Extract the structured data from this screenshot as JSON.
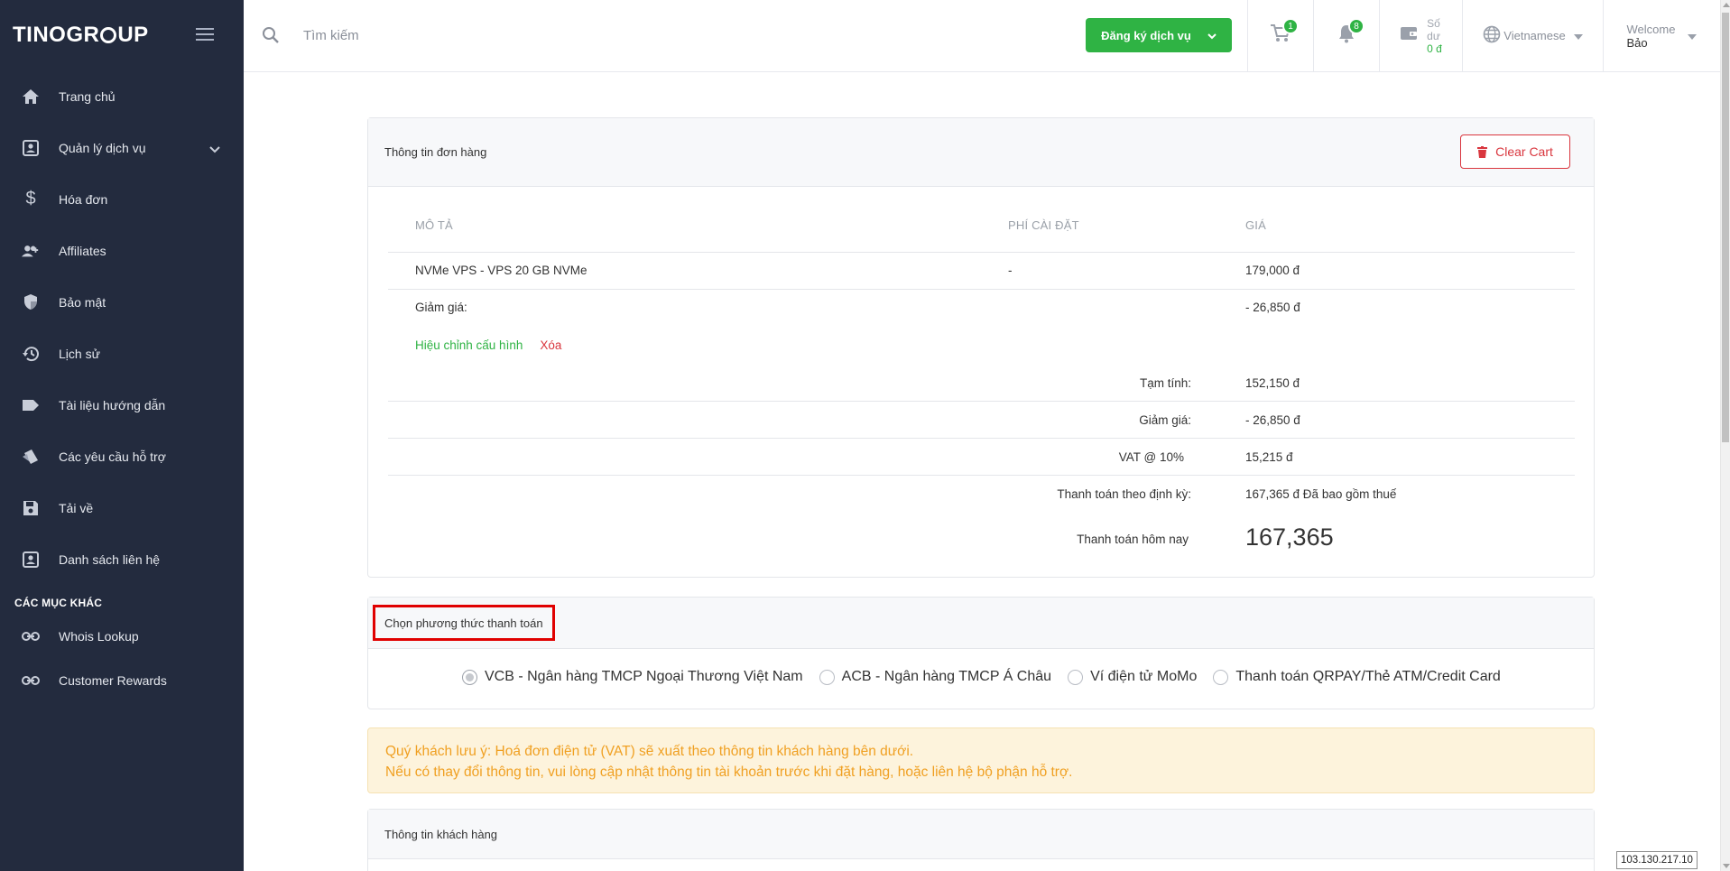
{
  "sidebar": {
    "logo": {
      "part1": "TINO",
      "part2": "GR",
      "part3": "UP"
    },
    "items": [
      {
        "label": "Trang chủ",
        "icon": "home-icon"
      },
      {
        "label": "Quản lý dịch vụ",
        "icon": "account-box-icon"
      },
      {
        "label": "Hóa đơn",
        "icon": "dollar-icon"
      },
      {
        "label": "Affiliates",
        "icon": "people-add-icon"
      },
      {
        "label": "Bảo mật",
        "icon": "shield-icon"
      },
      {
        "label": "Lịch sử",
        "icon": "history-icon"
      },
      {
        "label": "Tài liệu hướng dẫn",
        "icon": "label-icon"
      },
      {
        "label": "Các yêu cầu hỗ trợ",
        "icon": "ticket-icon"
      },
      {
        "label": "Tải về",
        "icon": "save-icon"
      },
      {
        "label": "Danh sách liên hệ",
        "icon": "contact-icon"
      }
    ],
    "section_title": "CÁC MỤC KHÁC",
    "other_items": [
      {
        "label": "Whois Lookup",
        "icon": "link-icon"
      },
      {
        "label": "Customer Rewards",
        "icon": "link-icon"
      }
    ]
  },
  "topbar": {
    "search_placeholder": "Tìm kiếm",
    "register_button": "Đăng ký dịch vụ",
    "cart_count": "1",
    "notification_count": "8",
    "balance_label_1": "Số",
    "balance_label_2": "dư",
    "balance_amount": "0 đ",
    "language": "Vietnamese",
    "welcome_label": "Welcome",
    "user_name": "Bảo"
  },
  "order": {
    "title": "Thông tin đơn hàng",
    "clear_cart": "Clear Cart",
    "columns": {
      "desc": "MÔ TẢ",
      "fee": "PHÍ CÀI ĐẶT",
      "price": "GIÁ"
    },
    "item": {
      "desc": "NVMe VPS - VPS 20 GB NVMe",
      "fee": "-",
      "price": "179,000 đ"
    },
    "discount": {
      "label": "Giảm giá:",
      "price": "- 26,850 đ"
    },
    "edit_config": "Hiệu chỉnh cấu hình",
    "remove": "Xóa",
    "summary": [
      {
        "label": "Tạm tính:",
        "value": "152,150 đ"
      },
      {
        "label": "Giảm giá:",
        "value": "- 26,850 đ"
      },
      {
        "label": "VAT @ 10%",
        "value": "15,215 đ"
      },
      {
        "label": "Thanh toán theo định kỳ:",
        "value": "167,365 đ Đã bao gồm thuế"
      }
    ],
    "today_label": "Thanh toán hôm nay",
    "today_value": "167,365"
  },
  "payment": {
    "title": "Chọn phương thức thanh toán",
    "options": [
      {
        "label": "VCB - Ngân hàng TMCP Ngoại Thương Việt Nam",
        "checked": true
      },
      {
        "label": "ACB - Ngân hàng TMCP Á Châu",
        "checked": false
      },
      {
        "label": "Ví điện tử MoMo",
        "checked": false
      },
      {
        "label": "Thanh toán QRPAY/Thẻ ATM/Credit Card",
        "checked": false
      }
    ]
  },
  "notice": {
    "line1": "Quý khách lưu ý: Hoá đơn điện tử (VAT) sẽ xuất theo thông tin khách hàng bên dưới.",
    "line2": "Nếu có thay đổi thông tin, vui lòng cập nhật thông tin tài khoản trước khi đặt hàng, hoặc liên hệ bộ phận hỗ trợ."
  },
  "customer": {
    "title": "Thông tin khách hàng"
  },
  "ip_address": "103.130.217.10",
  "colors": {
    "sidebar_bg": "#232b3e",
    "accent_green": "#2fb344",
    "danger_red": "#d9363e",
    "notice_text": "#f0a022",
    "notice_bg": "#fdf3dc"
  }
}
